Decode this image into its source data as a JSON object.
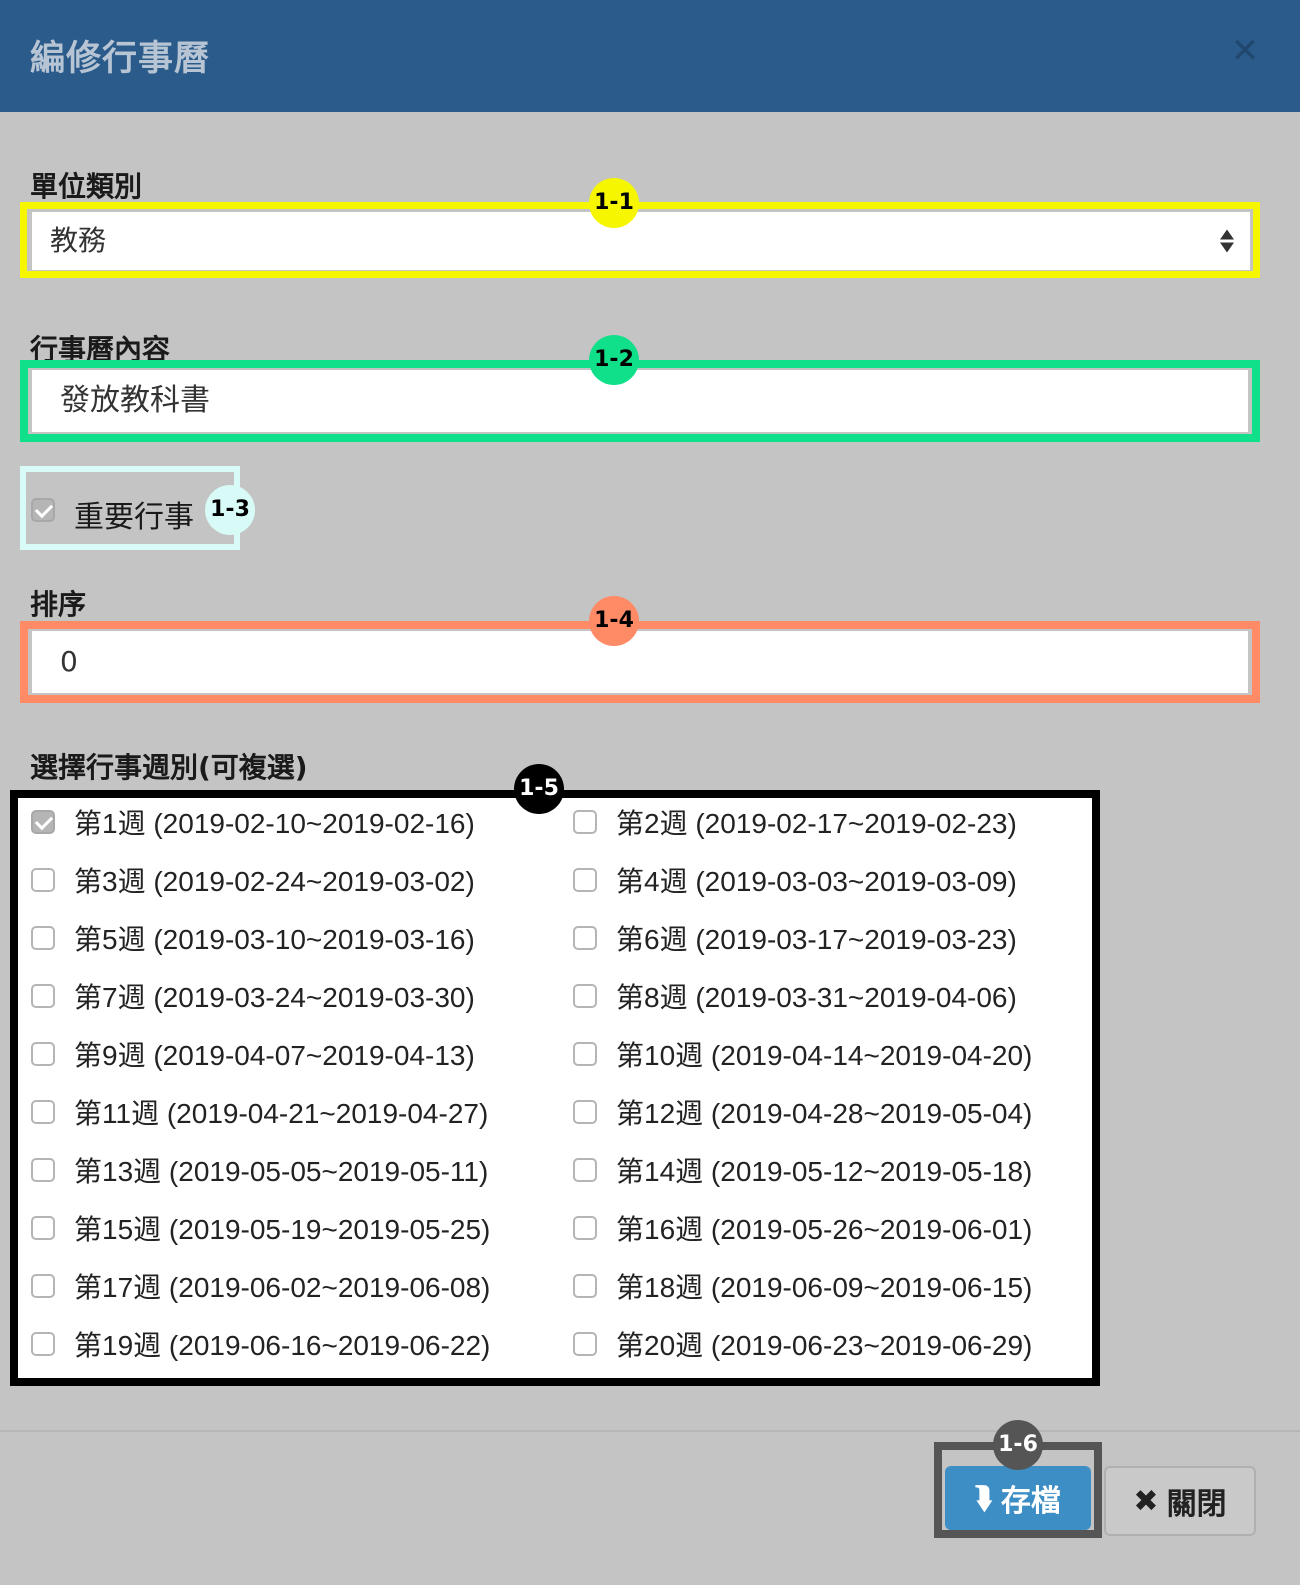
{
  "modal": {
    "title": "編修行事曆",
    "close_icon": "close-icon"
  },
  "unit": {
    "label": "單位類別",
    "value": "教務"
  },
  "content": {
    "label": "行事曆內容",
    "value": "發放教科書"
  },
  "important": {
    "label": "重要行事",
    "checked": true
  },
  "order": {
    "label": "排序",
    "value": "0"
  },
  "weeks": {
    "label": "選擇行事週別(可複選)",
    "items": [
      {
        "text": "第1週 (2019-02-10~2019-02-16)",
        "checked": true
      },
      {
        "text": "第2週 (2019-02-17~2019-02-23)",
        "checked": false
      },
      {
        "text": "第3週 (2019-02-24~2019-03-02)",
        "checked": false
      },
      {
        "text": "第4週 (2019-03-03~2019-03-09)",
        "checked": false
      },
      {
        "text": "第5週 (2019-03-10~2019-03-16)",
        "checked": false
      },
      {
        "text": "第6週 (2019-03-17~2019-03-23)",
        "checked": false
      },
      {
        "text": "第7週 (2019-03-24~2019-03-30)",
        "checked": false
      },
      {
        "text": "第8週 (2019-03-31~2019-04-06)",
        "checked": false
      },
      {
        "text": "第9週 (2019-04-07~2019-04-13)",
        "checked": false
      },
      {
        "text": "第10週 (2019-04-14~2019-04-20)",
        "checked": false
      },
      {
        "text": "第11週 (2019-04-21~2019-04-27)",
        "checked": false
      },
      {
        "text": "第12週 (2019-04-28~2019-05-04)",
        "checked": false
      },
      {
        "text": "第13週 (2019-05-05~2019-05-11)",
        "checked": false
      },
      {
        "text": "第14週 (2019-05-12~2019-05-18)",
        "checked": false
      },
      {
        "text": "第15週 (2019-05-19~2019-05-25)",
        "checked": false
      },
      {
        "text": "第16週 (2019-05-26~2019-06-01)",
        "checked": false
      },
      {
        "text": "第17週 (2019-06-02~2019-06-08)",
        "checked": false
      },
      {
        "text": "第18週 (2019-06-09~2019-06-15)",
        "checked": false
      },
      {
        "text": "第19週 (2019-06-16~2019-06-22)",
        "checked": false
      },
      {
        "text": "第20週 (2019-06-23~2019-06-29)",
        "checked": false
      }
    ]
  },
  "annotations": [
    {
      "label": "1-1",
      "color": "#f6f600",
      "text_color": "#000000"
    },
    {
      "label": "1-2",
      "color": "#11e08a",
      "text_color": "#000000"
    },
    {
      "label": "1-3",
      "color": "#d9fbf8",
      "text_color": "#000000"
    },
    {
      "label": "1-4",
      "color": "#ff8a66",
      "text_color": "#000000"
    },
    {
      "label": "1-5",
      "color": "#000000",
      "text_color": "#ffffff"
    },
    {
      "label": "1-6",
      "color": "#555555",
      "text_color": "#ffffff"
    }
  ],
  "footer": {
    "save_label": "存檔",
    "save_icon": "save-icon",
    "close_label": "關閉",
    "close_icon": "close-icon"
  },
  "colors": {
    "header": "#2a5b8a",
    "save_button": "#3c8ec4"
  }
}
